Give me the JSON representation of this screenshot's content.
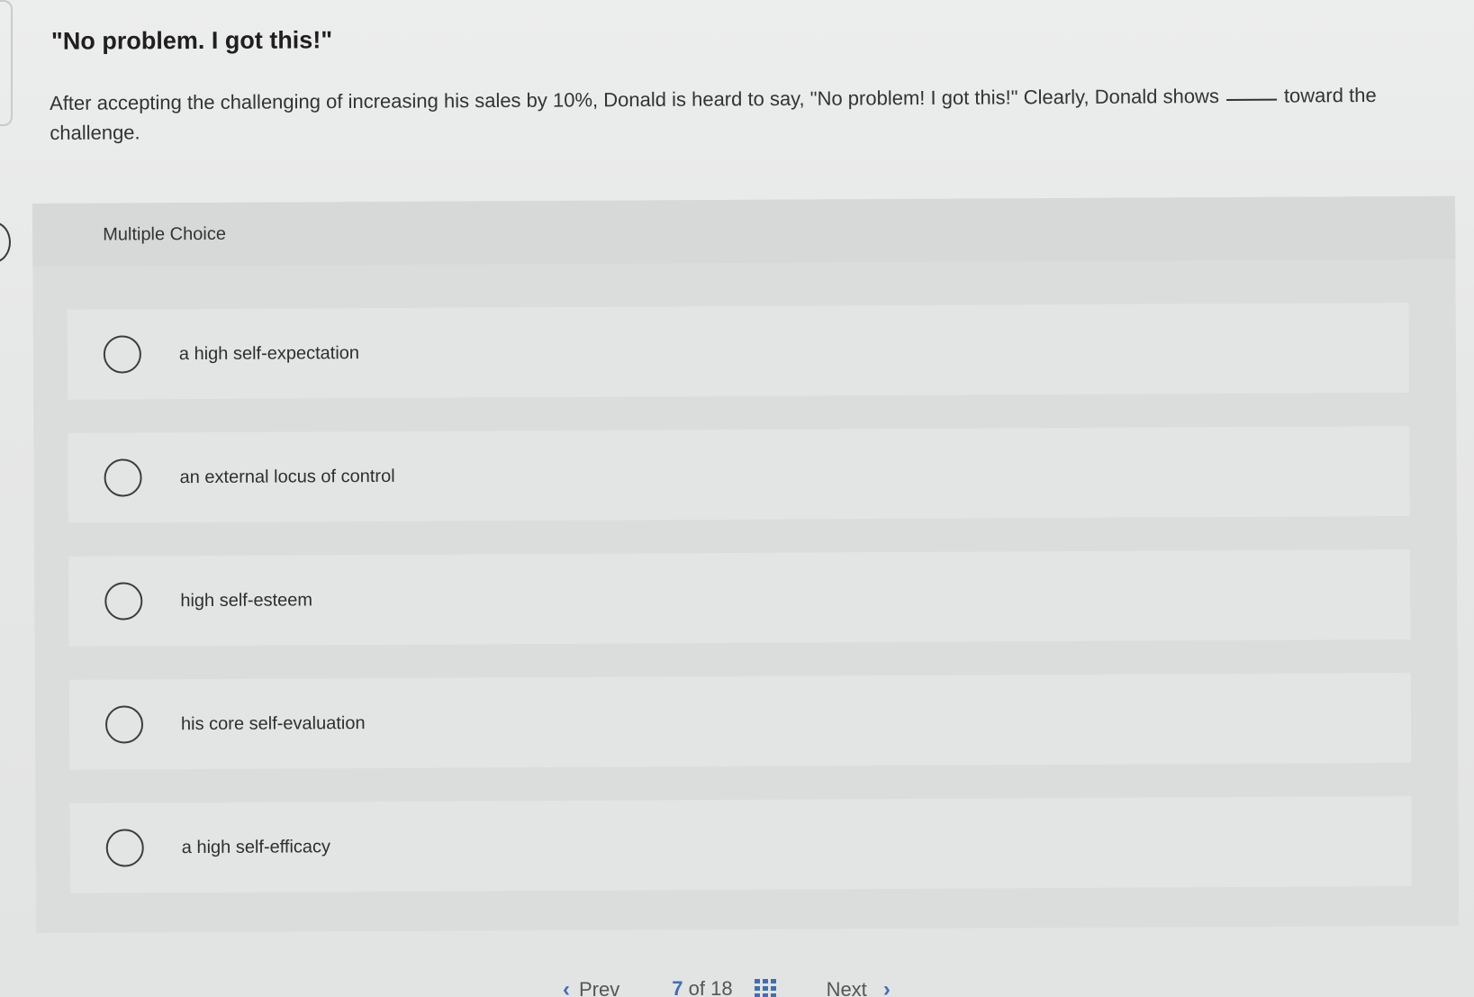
{
  "question": {
    "title": "\"No problem. I got this!\"",
    "body_before_blank": "After accepting the challenging of increasing his sales by 10%, Donald is heard to say, \"No problem! I got this!\" Clearly, Donald shows",
    "body_after_blank": "toward the challenge."
  },
  "multiple_choice": {
    "label": "Multiple Choice",
    "options": [
      {
        "text": "a high self-expectation",
        "selected": false
      },
      {
        "text": "an external locus of control",
        "selected": false
      },
      {
        "text": "high self-esteem",
        "selected": false
      },
      {
        "text": "his core self-evaluation",
        "selected": false
      },
      {
        "text": "a high self-efficacy",
        "selected": false
      }
    ]
  },
  "pager": {
    "prev_label": "Prev",
    "current": "7",
    "of_label": "of 18",
    "next_label": "Next",
    "prev_icon": "chevron-left-icon",
    "next_icon": "chevron-right-icon",
    "grid_icon": "grid-icon"
  },
  "colors": {
    "accent": "#3f6fb3",
    "card": "#dbdcdc",
    "option_bg": "#e3e4e4"
  }
}
